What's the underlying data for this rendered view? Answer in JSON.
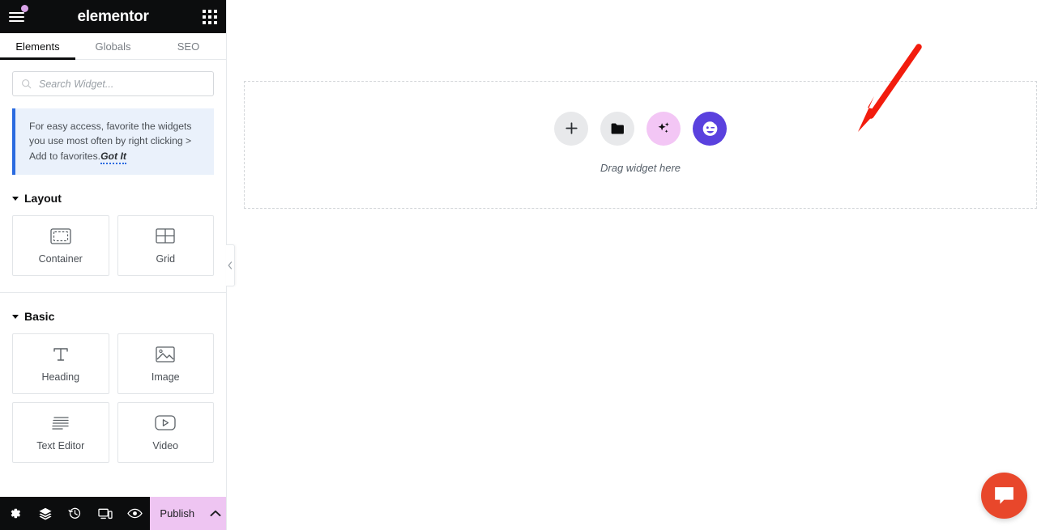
{
  "panel": {
    "header": {
      "brand": "elementor",
      "menu_icon": "hamburger-icon",
      "apps_icon": "apps-grid-icon",
      "has_notification_dot": true
    },
    "tabs": [
      {
        "label": "Elements",
        "active": true
      },
      {
        "label": "Globals",
        "active": false
      },
      {
        "label": "SEO",
        "active": false
      }
    ],
    "search": {
      "placeholder": "Search Widget...",
      "value": "",
      "icon": "search-icon"
    },
    "notice": {
      "text": "For easy access, favorite the widgets you use most often by right clicking > Add to favorites.",
      "action_label": "Got It",
      "accent_color": "#2b6be0",
      "background": "#eaf1fb"
    },
    "sections": [
      {
        "title": "Layout",
        "widgets": [
          {
            "label": "Container",
            "icon": "container-icon"
          },
          {
            "label": "Grid",
            "icon": "grid-icon"
          }
        ]
      },
      {
        "title": "Basic",
        "widgets": [
          {
            "label": "Heading",
            "icon": "heading-t-icon"
          },
          {
            "label": "Image",
            "icon": "image-icon"
          },
          {
            "label": "Text Editor",
            "icon": "text-editor-icon"
          },
          {
            "label": "Video",
            "icon": "video-play-icon"
          }
        ]
      }
    ],
    "footer": {
      "tools": [
        {
          "name": "settings-gear-icon",
          "title": "Settings"
        },
        {
          "name": "navigator-layers-icon",
          "title": "Navigator"
        },
        {
          "name": "history-clock-icon",
          "title": "History"
        },
        {
          "name": "responsive-device-icon",
          "title": "Responsive Mode"
        },
        {
          "name": "preview-eye-icon",
          "title": "Preview Changes"
        }
      ],
      "publish_label": "Publish",
      "publish_color": "#eec5f2",
      "publish_caret_icon": "chevron-up-icon"
    },
    "collapse_handle_icon": "chevron-left-icon"
  },
  "canvas": {
    "drop_area": {
      "hint": "Drag widget here",
      "buttons": [
        {
          "name": "add-element-button",
          "icon": "plus-icon",
          "color": "#e8e9eb"
        },
        {
          "name": "open-folder-button",
          "icon": "folder-icon",
          "color": "#e8e9eb"
        },
        {
          "name": "ai-generate-button",
          "icon": "sparkle-ai-icon",
          "color": "#f3c6f5"
        },
        {
          "name": "assistant-bot-button",
          "icon": "winking-face-icon",
          "color": "#5a41de"
        }
      ]
    },
    "annotation": {
      "type": "red-arrow",
      "color": "#f21c0d",
      "points_to": "open-folder-button"
    },
    "chat_fab": {
      "icon": "chat-bubble-icon",
      "color": "#e8472b"
    }
  }
}
